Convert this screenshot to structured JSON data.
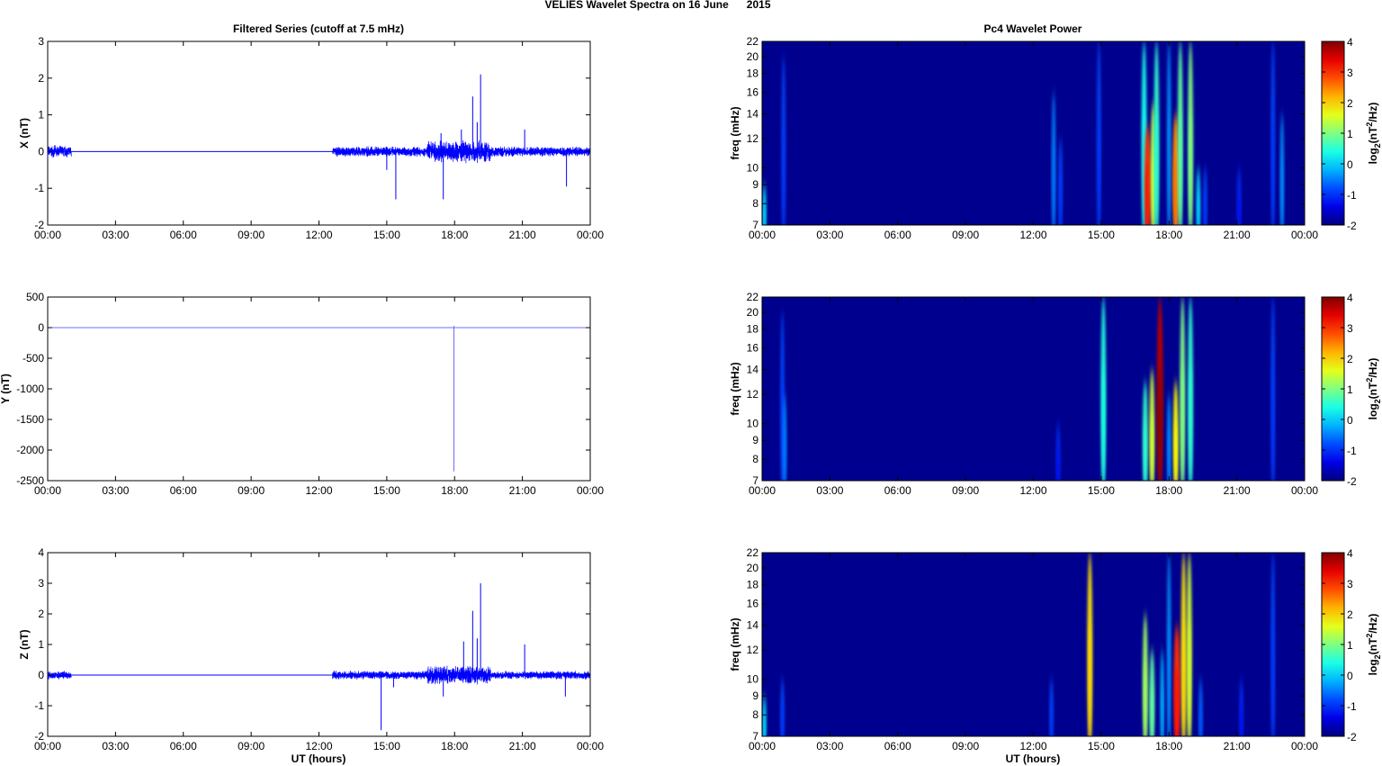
{
  "chart_data": {
    "title": "VELIES Wavelet Spectra on 16 June      2015",
    "left_title": "Filtered Series (cutoff at 7.5 mHz)",
    "right_title": "Pc4 Wavelet Power",
    "xlabel": "UT (hours)",
    "x_ticks": [
      "00:00",
      "03:00",
      "06:00",
      "09:00",
      "12:00",
      "15:00",
      "18:00",
      "21:00",
      "00:00"
    ],
    "xlim_hours": [
      0,
      24
    ],
    "series_color": "#0000ff",
    "time_series": [
      {
        "type": "line",
        "ylabel": "X (nT)",
        "ylim": [
          -2,
          3
        ],
        "yticks": [
          -2,
          -1,
          0,
          1,
          2,
          3
        ],
        "segments": [
          {
            "start": 0,
            "end": 1.05,
            "noise": 0.12
          },
          {
            "start": 12.6,
            "end": 24,
            "noise": 0.1
          }
        ],
        "active_hours": [
          16.8,
          19.6
        ],
        "spikes": [
          [
            15.4,
            -1.3
          ],
          [
            17.5,
            -1.3
          ],
          [
            17.4,
            0.5
          ],
          [
            18.8,
            1.5
          ],
          [
            19.0,
            0.8
          ],
          [
            19.15,
            2.1
          ],
          [
            18.3,
            0.6
          ],
          [
            21.1,
            0.6
          ],
          [
            22.95,
            -0.95
          ],
          [
            15.0,
            -0.5
          ]
        ]
      },
      {
        "type": "line",
        "ylabel": "Y (nT)",
        "ylim": [
          -2500,
          500
        ],
        "yticks": [
          -2500,
          -2000,
          -1500,
          -1000,
          -500,
          0,
          500
        ],
        "segments": [],
        "active_hours": [],
        "spikes": [
          [
            17.97,
            -2350
          ],
          [
            17.97,
            30
          ]
        ]
      },
      {
        "type": "line",
        "ylabel": "Z (nT)",
        "ylim": [
          -2,
          4
        ],
        "yticks": [
          -2,
          -1,
          0,
          1,
          2,
          3,
          4
        ],
        "segments": [
          {
            "start": 0,
            "end": 1.05,
            "noise": 0.1
          },
          {
            "start": 12.6,
            "end": 24,
            "noise": 0.1
          }
        ],
        "active_hours": [
          16.8,
          19.6
        ],
        "spikes": [
          [
            14.75,
            -1.8
          ],
          [
            18.8,
            2.1
          ],
          [
            19.15,
            3.0
          ],
          [
            19.0,
            1.2
          ],
          [
            18.4,
            1.1
          ],
          [
            21.1,
            1.0
          ],
          [
            17.5,
            -0.7
          ],
          [
            15.3,
            -0.4
          ],
          [
            22.9,
            -0.7
          ]
        ]
      }
    ],
    "spectrograms": [
      {
        "type": "heatmap",
        "ylabel": "freq (mHz)",
        "ylim": [
          7,
          22
        ],
        "yticks": [
          7,
          8,
          9,
          10,
          12,
          14,
          16,
          18,
          20,
          22
        ],
        "events": [
          [
            0.1,
            7,
            9,
            0
          ],
          [
            0.95,
            7,
            20,
            -1
          ],
          [
            12.9,
            7,
            16,
            -0.6
          ],
          [
            13.2,
            7,
            12,
            -1
          ],
          [
            14.9,
            7,
            22,
            -1
          ],
          [
            16.9,
            7,
            22,
            0.3
          ],
          [
            17.05,
            7,
            13,
            3.2
          ],
          [
            17.3,
            7,
            15,
            1.5
          ],
          [
            17.45,
            7,
            22,
            0.5
          ],
          [
            18.0,
            7,
            22,
            -0.5
          ],
          [
            18.3,
            7,
            14,
            2.6
          ],
          [
            18.5,
            7,
            22,
            0.8
          ],
          [
            18.95,
            7,
            22,
            1
          ],
          [
            19.3,
            7,
            10,
            0
          ],
          [
            19.6,
            7,
            10,
            -1
          ],
          [
            21.1,
            7,
            10,
            -1.2
          ],
          [
            22.6,
            7,
            22,
            -1
          ],
          [
            23.0,
            7,
            14,
            -0.5
          ]
        ]
      },
      {
        "type": "heatmap",
        "ylabel": "freq (mHz)",
        "ylim": [
          7,
          22
        ],
        "yticks": [
          7,
          8,
          9,
          10,
          12,
          14,
          16,
          18,
          20,
          22
        ],
        "events": [
          [
            0.9,
            7,
            20,
            -1
          ],
          [
            1.0,
            7,
            12,
            -0.6
          ],
          [
            13.1,
            7,
            10,
            -1.2
          ],
          [
            15.1,
            7,
            22,
            0.4
          ],
          [
            16.95,
            7,
            13,
            0.5
          ],
          [
            17.25,
            7,
            14,
            1.5
          ],
          [
            17.6,
            7,
            22,
            4
          ],
          [
            18.0,
            7,
            12,
            -0.5
          ],
          [
            18.3,
            7,
            13,
            1.8
          ],
          [
            18.6,
            7,
            22,
            1
          ],
          [
            18.95,
            7,
            22,
            0.5
          ],
          [
            22.6,
            7,
            22,
            -1
          ]
        ]
      },
      {
        "type": "heatmap",
        "ylabel": "freq (mHz)",
        "ylim": [
          7,
          22
        ],
        "yticks": [
          7,
          8,
          9,
          10,
          12,
          14,
          16,
          18,
          20,
          22
        ],
        "events": [
          [
            0.1,
            7,
            9,
            0
          ],
          [
            0.9,
            7,
            10,
            -1
          ],
          [
            12.8,
            7,
            10,
            -1
          ],
          [
            14.5,
            7,
            22,
            2
          ],
          [
            16.95,
            7,
            15,
            1.2
          ],
          [
            17.25,
            7,
            12,
            0.8
          ],
          [
            17.7,
            7,
            12,
            -0.3
          ],
          [
            18.0,
            7,
            22,
            -0.5
          ],
          [
            18.35,
            7,
            14,
            3.2
          ],
          [
            18.65,
            7,
            22,
            2
          ],
          [
            18.9,
            7,
            22,
            1.5
          ],
          [
            19.4,
            7,
            10,
            -0.8
          ],
          [
            21.2,
            7,
            10,
            -1.2
          ],
          [
            22.6,
            7,
            22,
            -1
          ]
        ]
      }
    ],
    "colorbar": {
      "label": "log2(nT2/Hz)",
      "label_main": "log",
      "label_sub": "2",
      "label_rest": "(nT",
      "label_sup": "2",
      "label_end": "/Hz)",
      "range": [
        -2,
        4
      ],
      "ticks": [
        -2,
        -1,
        0,
        1,
        2,
        3,
        4
      ],
      "colormap": "jet",
      "background": "#00008f"
    }
  }
}
